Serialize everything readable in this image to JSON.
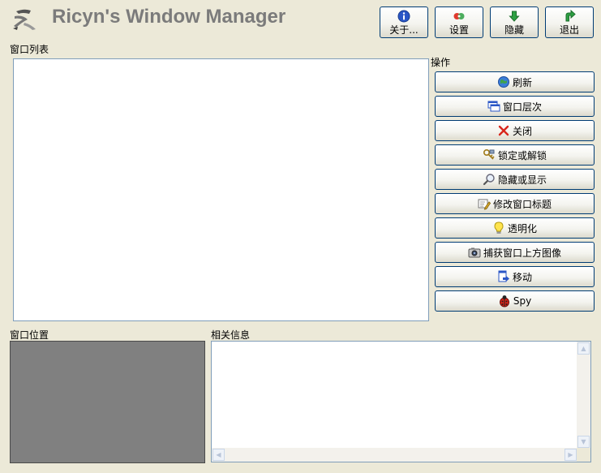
{
  "app": {
    "title": "Ricyn's Window Manager"
  },
  "toolbar": {
    "about_label": "关于...",
    "settings_label": "设置",
    "hide_label": "隐藏",
    "exit_label": "退出"
  },
  "window_list": {
    "label": "窗口列表"
  },
  "operations": {
    "label": "操作",
    "buttons": [
      {
        "label": "刷新",
        "icon": "refresh-globe-icon"
      },
      {
        "label": "窗口层次",
        "icon": "window-hierarchy-icon"
      },
      {
        "label": "关闭",
        "icon": "close-x-icon"
      },
      {
        "label": "锁定或解锁",
        "icon": "key-lock-icon"
      },
      {
        "label": "隐藏或显示",
        "icon": "magnifier-icon"
      },
      {
        "label": "修改窗口标题",
        "icon": "edit-title-icon"
      },
      {
        "label": "透明化",
        "icon": "lightbulb-icon"
      },
      {
        "label": "捕获窗口上方图像",
        "icon": "camera-icon"
      },
      {
        "label": "移动",
        "icon": "move-icon"
      },
      {
        "label": "Spy",
        "icon": "ladybug-icon"
      }
    ]
  },
  "position_panel": {
    "label": "窗口位置"
  },
  "info_panel": {
    "label": "相关信息",
    "text": ""
  },
  "colors": {
    "background": "#ECE9D8",
    "title_text": "#7b7b7b",
    "preview_fill": "#808080",
    "button_border": "#003C74"
  }
}
